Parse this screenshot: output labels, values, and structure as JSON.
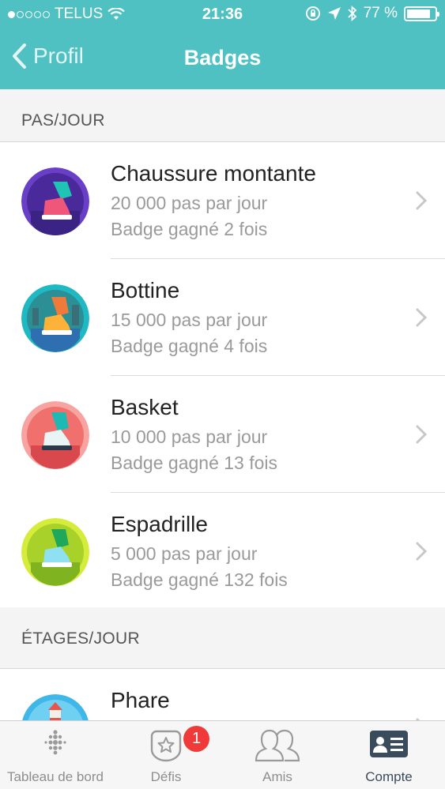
{
  "status_bar": {
    "carrier": "TELUS",
    "time": "21:36",
    "battery": "77 %",
    "battery_level": 0.77
  },
  "nav": {
    "back_label": "Profil",
    "title": "Badges"
  },
  "sections": [
    {
      "header": "PAS/JOUR",
      "items": [
        {
          "name": "Chaussure montante",
          "goal": "20 000 pas par jour",
          "earned": "Badge gagné 2 fois",
          "icon": "high-top-shoe-badge-icon",
          "color": "#6a3fc8"
        },
        {
          "name": "Bottine",
          "goal": "15 000 pas par jour",
          "earned": "Badge gagné 4 fois",
          "icon": "boot-badge-icon",
          "color": "#1fb9c3"
        },
        {
          "name": "Basket",
          "goal": "10 000 pas par jour",
          "earned": "Badge gagné 13 fois",
          "icon": "sneaker-badge-icon",
          "color": "#f0706e"
        },
        {
          "name": "Espadrille",
          "goal": "5 000 pas par jour",
          "earned": "Badge gagné 132 fois",
          "icon": "espadrille-badge-icon",
          "color": "#b7dc2a"
        }
      ]
    },
    {
      "header": "ÉTAGES/JOUR",
      "items": [
        {
          "name": "Phare",
          "icon": "lighthouse-badge-icon",
          "color": "#3fb7e8"
        }
      ]
    }
  ],
  "tabbar": {
    "tabs": [
      {
        "label": "Tableau de bord",
        "icon": "dashboard-dots-icon"
      },
      {
        "label": "Défis",
        "icon": "challenge-star-icon",
        "badge": "1"
      },
      {
        "label": "Amis",
        "icon": "friends-icon"
      },
      {
        "label": "Compte",
        "icon": "account-card-icon",
        "active": true
      }
    ]
  },
  "colors": {
    "header": "#4fc1c2",
    "notification": "#f03a3a",
    "active_tab": "#3a4b5c"
  }
}
